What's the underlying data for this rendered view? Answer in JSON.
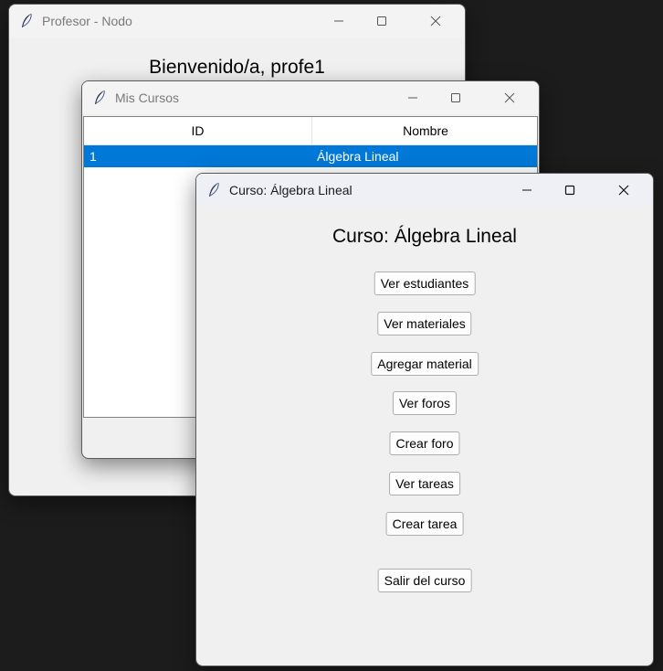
{
  "windows": {
    "profesor": {
      "title": "Profesor - Nodo",
      "welcome": "Bienvenido/a, profe1"
    },
    "cursos": {
      "title": "Mis Cursos",
      "columns": [
        "ID",
        "Nombre"
      ],
      "rows": [
        {
          "id": "1",
          "nombre": "Álgebra Lineal",
          "selected": true
        }
      ]
    },
    "curso": {
      "title": "Curso: Álgebra Lineal",
      "heading": "Curso: Álgebra Lineal",
      "buttons": {
        "ver_estudiantes": "Ver estudiantes",
        "ver_materiales": "Ver materiales",
        "agregar_material": "Agregar material",
        "ver_foros": "Ver foros",
        "crear_foro": "Crear foro",
        "ver_tareas": "Ver tareas",
        "crear_tarea": "Crear tarea",
        "salir": "Salir del curso"
      }
    }
  },
  "icons": {
    "app": "feather-icon",
    "minimize": "minimize-icon",
    "maximize": "maximize-icon",
    "close": "close-icon"
  },
  "colors": {
    "desktop": "#1c1c1c",
    "window_bg": "#f0f0f0",
    "selection": "#0078d7",
    "selection_text": "#ffffff"
  }
}
